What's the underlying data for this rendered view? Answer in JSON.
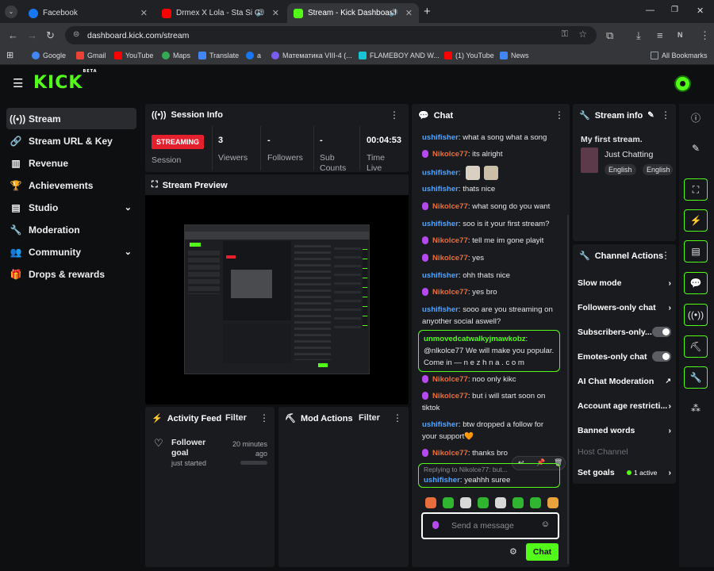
{
  "browser": {
    "tabs": [
      {
        "title": "Facebook",
        "color": "#1877f2"
      },
      {
        "title": "Drmex X Lola - Sta Si Cula -",
        "color": "#ff0000"
      },
      {
        "title": "Stream - Kick Dashboard",
        "color": "#53fc18"
      }
    ],
    "url": "dashboard.kick.com/stream",
    "bookmarks": [
      {
        "label": "Google",
        "color": "#4285f4"
      },
      {
        "label": "Gmail",
        "color": "#ea4335"
      },
      {
        "label": "YouTube",
        "color": "#ff0000"
      },
      {
        "label": "Maps",
        "color": "#34a853"
      },
      {
        "label": "Translate",
        "color": "#4285f4"
      },
      {
        "label": "a",
        "color": "#1877f2"
      },
      {
        "label": "Математика VIII-4 (...",
        "color": "#7b5cf0"
      },
      {
        "label": "FLAMEBOY AND W...",
        "color": "#19c3d6"
      },
      {
        "label": "(1) YouTube",
        "color": "#ff0000"
      },
      {
        "label": "News",
        "color": "#4285f4"
      },
      {
        "label": "All Bookmarks",
        "color": "#9aa0a6"
      }
    ],
    "profile_initial": "N"
  },
  "kick": {
    "logo": "KICK",
    "logo_sup": "BETA",
    "sidebar": [
      {
        "label": "Stream",
        "icon": "broadcast-icon"
      },
      {
        "label": "Stream URL & Key",
        "icon": "link-icon"
      },
      {
        "label": "Revenue",
        "icon": "chart-icon"
      },
      {
        "label": "Achievements",
        "icon": "trophy-icon"
      },
      {
        "label": "Studio",
        "icon": "studio-icon"
      },
      {
        "label": "Moderation",
        "icon": "wrench-icon"
      },
      {
        "label": "Community",
        "icon": "people-icon"
      },
      {
        "label": "Drops & rewards",
        "icon": "gift-icon"
      }
    ],
    "session": {
      "title": "Session Info",
      "badge": "STREAMING",
      "label": "Session",
      "stats": [
        {
          "value": "3",
          "label": "Viewers"
        },
        {
          "value": "-",
          "label": "Followers"
        },
        {
          "value": "-",
          "label": "Sub Counts"
        },
        {
          "value": "00:04:53",
          "label": "Time Live"
        }
      ]
    },
    "preview": {
      "title": "Stream Preview"
    },
    "activity": {
      "title": "Activity Feed",
      "filter": "Filter",
      "item_title": "Follower goal",
      "item_sub": "just started",
      "item_time": "20 minutes ago"
    },
    "mod": {
      "title": "Mod Actions",
      "filter": "Filter"
    },
    "chat": {
      "title": "Chat",
      "messages": [
        {
          "user": "ushifisher",
          "text": ": what a song what a song",
          "kind": "u"
        },
        {
          "user": "Nikolce77",
          "text": ": its alright",
          "kind": "n"
        },
        {
          "user": "ushifisher",
          "text": ":",
          "kind": "u"
        },
        {
          "user": "ushifisher",
          "text": ": thats nice",
          "kind": "u"
        },
        {
          "user": "Nikolce77",
          "text": ": what song do you want",
          "kind": "n"
        },
        {
          "user": "ushifisher",
          "text": ": soo is it your first stream?",
          "kind": "u"
        },
        {
          "user": "Nikolce77",
          "text": ": tell me im gone playit",
          "kind": "n"
        },
        {
          "user": "Nikolce77",
          "text": ": yes",
          "kind": "n"
        },
        {
          "user": "ushifisher",
          "text": ": ohh thats nice",
          "kind": "u"
        },
        {
          "user": "Nikolce77",
          "text": ": yes bro",
          "kind": "n"
        },
        {
          "user": "ushifisher",
          "text": ": sooo are you streaming on anyother social aswell?",
          "kind": "u"
        },
        {
          "user": "unmovedcatwalkyjmawkobz",
          "text": ": @nlkolce77 We will make you popular. Come in — n e z h n a . c o m",
          "kind": "g"
        },
        {
          "user": "Nikolce77",
          "text": ": noo only kikc",
          "kind": "n"
        },
        {
          "user": "Nikolce77",
          "text": ": but i will start soon on tiktok",
          "kind": "n"
        },
        {
          "user": "ushifisher",
          "text": ": btw dropped a follow for your support🧡",
          "kind": "u"
        },
        {
          "user": "Nikolce77",
          "text": ": thanks bro",
          "kind": "n"
        }
      ],
      "reply_banner": "Replying to Nikolce77: but...",
      "last_user": "ushifisher",
      "last_text": ": yeahhh suree",
      "input_placeholder": "Send a message",
      "send_label": "Chat"
    },
    "stream_info": {
      "title": "Stream info",
      "stream_title": "My first stream.",
      "category": "Just Chatting",
      "tags": [
        "English",
        "English"
      ]
    },
    "channel_actions": {
      "title": "Channel Actions",
      "items": [
        {
          "label": "Slow mode",
          "control": "chevron"
        },
        {
          "label": "Followers-only chat",
          "control": "chevron"
        },
        {
          "label": "Subscribers-only...",
          "control": "toggle"
        },
        {
          "label": "Emotes-only chat",
          "control": "toggle"
        },
        {
          "label": "AI Chat Moderation",
          "control": "external"
        },
        {
          "label": "Account age restricti...",
          "control": "chevron"
        },
        {
          "label": "Banned words",
          "control": "chevron"
        }
      ],
      "host_label": "Host Channel",
      "goals_label": "Set goals",
      "goals_status": "1 active"
    }
  }
}
